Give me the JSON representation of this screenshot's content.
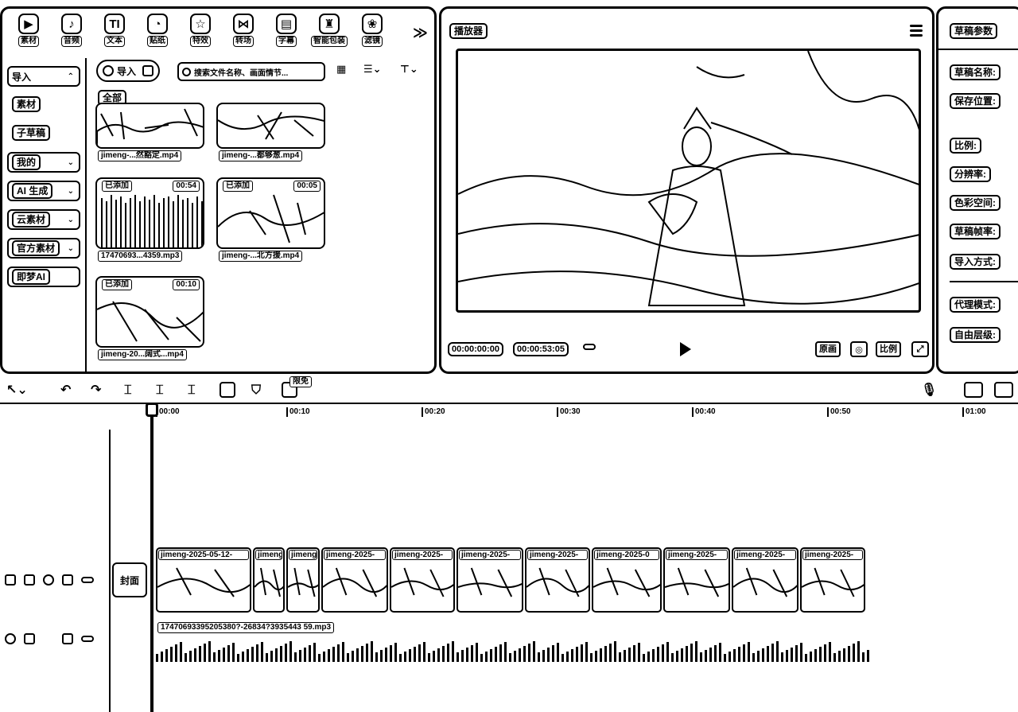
{
  "media_tools": [
    {
      "label": "素材",
      "icon": "media-icon",
      "glyph": "▶"
    },
    {
      "label": "音频",
      "icon": "audio-icon",
      "glyph": "♪"
    },
    {
      "label": "文本",
      "icon": "text-icon",
      "glyph": "TI"
    },
    {
      "label": "贴纸",
      "icon": "sticker-icon",
      "glyph": "◔"
    },
    {
      "label": "特效",
      "icon": "effects-icon",
      "glyph": "☆"
    },
    {
      "label": "转场",
      "icon": "transition-icon",
      "glyph": "⋈"
    },
    {
      "label": "字幕",
      "icon": "caption-icon",
      "glyph": "▤"
    },
    {
      "label": "智能包装",
      "icon": "smart-pack-icon",
      "glyph": "♜"
    },
    {
      "label": "滤镜",
      "icon": "filter-icon",
      "glyph": "❀"
    }
  ],
  "more_symbol": "≫",
  "sidebar": {
    "import_label": "导入",
    "items": [
      {
        "label": "素材"
      },
      {
        "label": "子草稿"
      },
      {
        "label": "我的"
      },
      {
        "label": "AI 生成"
      },
      {
        "label": "云素材"
      },
      {
        "label": "官方素材"
      },
      {
        "label": "即梦AI"
      }
    ]
  },
  "media_toolbar": {
    "import_button": "导入",
    "search_placeholder": "搜索文件名称、画面情节..."
  },
  "media_items": [
    {
      "group": "全部",
      "name": "jimeng-...然豁定.mp4",
      "tag": "",
      "duration": ""
    },
    {
      "name": "jimeng-...都够葱.mp4",
      "tag": "",
      "duration": ""
    },
    {
      "name": "17470693...4359.mp3",
      "tag": "已添加",
      "duration": "00:54"
    },
    {
      "name": "jimeng-...北方援.mp4",
      "tag": "已添加",
      "duration": "00:05"
    },
    {
      "name": "jimeng-20...阔式...mp4",
      "tag": "已添加",
      "duration": "00:10"
    }
  ],
  "player": {
    "title": "播放器",
    "current_time": "00:00:00:00",
    "total_time": "00:00:53:05",
    "original_button": "原画",
    "ratio_button": "比例"
  },
  "draft_params": {
    "title": "草稿参数",
    "fields": [
      "草稿名称:",
      "保存位置:",
      "比例:",
      "分辨率:",
      "色彩空间:",
      "草稿帧率:",
      "导入方式:",
      "代理模式:",
      "自由层级:"
    ]
  },
  "timeline": {
    "ruler": [
      "00:00",
      "00:10",
      "00:20",
      "00:30",
      "00:40",
      "00:50",
      "01:00"
    ],
    "first_badge": "限免",
    "cover_label": "封面",
    "clips": [
      "jimeng-2025-05-12-",
      "jimeng",
      "jimeng",
      "jimeng-2025-",
      "jimeng-2025-",
      "jimeng-2025-",
      "jimeng-2025-",
      "jimeng-2025-0",
      "jimeng-2025-",
      "jimeng-2025-",
      "jimeng-2025-"
    ],
    "audio_label": "17470693395205380?-26834?3935443 59.mp3"
  }
}
